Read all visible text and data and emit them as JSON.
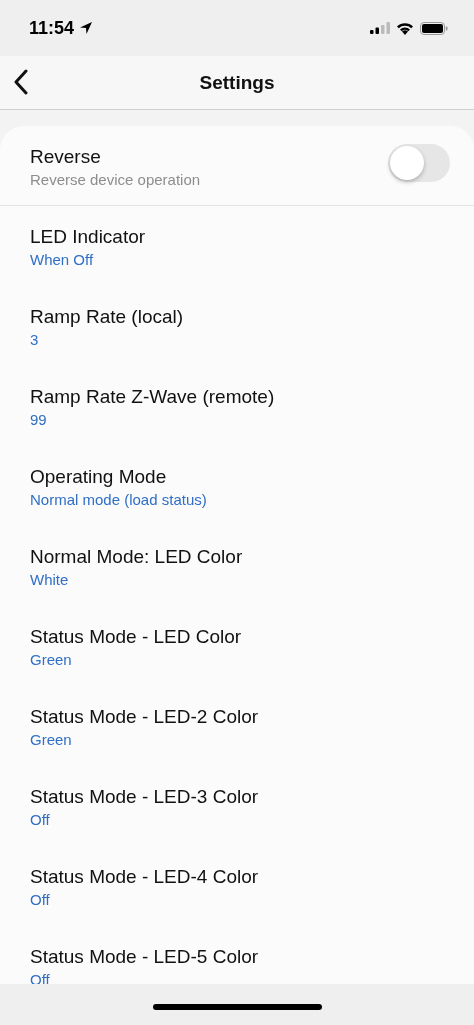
{
  "status_bar": {
    "time": "11:54"
  },
  "nav": {
    "title": "Settings"
  },
  "settings": [
    {
      "kind": "toggle",
      "title": "Reverse",
      "subtitle": "Reverse device operation",
      "on": false
    },
    {
      "kind": "value",
      "title": "LED Indicator",
      "value": "When Off"
    },
    {
      "kind": "value",
      "title": "Ramp Rate (local)",
      "value": "3"
    },
    {
      "kind": "value",
      "title": "Ramp Rate Z-Wave (remote)",
      "value": "99"
    },
    {
      "kind": "value",
      "title": "Operating Mode",
      "value": "Normal mode (load status)"
    },
    {
      "kind": "value",
      "title": "Normal Mode: LED Color",
      "value": "White"
    },
    {
      "kind": "value",
      "title": "Status Mode - LED Color",
      "value": "Green"
    },
    {
      "kind": "value",
      "title": "Status Mode - LED-2 Color",
      "value": "Green"
    },
    {
      "kind": "value",
      "title": "Status Mode - LED-3 Color",
      "value": "Off"
    },
    {
      "kind": "value",
      "title": "Status Mode - LED-4 Color",
      "value": "Off"
    },
    {
      "kind": "value",
      "title": "Status Mode - LED-5 Color",
      "value": "Off"
    }
  ]
}
